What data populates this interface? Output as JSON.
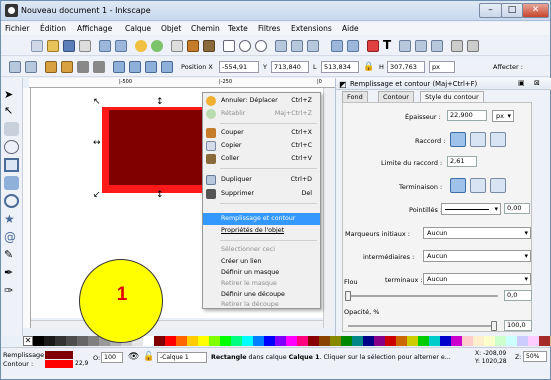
{
  "window": {
    "title": "Nouveau document 1 - Inkscape",
    "min": "–",
    "max": "□",
    "close": "✕"
  },
  "menu": [
    "Fichier",
    "Édition",
    "Affichage",
    "Calque",
    "Objet",
    "Chemin",
    "Texte",
    "Filtres",
    "Extensions",
    "Aide"
  ],
  "toolbar": {
    "position_x_label": "Position X",
    "x_value": "-554,91",
    "y_label": "Y",
    "y_value": "713,840",
    "w_label": "L",
    "w_value": "513,834",
    "h_label": "H",
    "h_value": "307,763",
    "unit": "px",
    "affecter": "Affecter :"
  },
  "ruler": {
    "tick_1": "|-500",
    "tick_2": "|-250",
    "tick_3": "|0"
  },
  "context_menu": [
    {
      "label": "Annuler: Déplacer",
      "shortcut": "Ctrl+Z",
      "disabled": false,
      "icon": "undo-icon"
    },
    {
      "label": "Rétablir",
      "shortcut": "Maj+Ctrl+Z",
      "disabled": true,
      "icon": "redo-icon"
    },
    {
      "label": "Couper",
      "shortcut": "Ctrl+X",
      "disabled": false,
      "icon": "cut-icon"
    },
    {
      "label": "Copier",
      "shortcut": "Ctrl+C",
      "disabled": false,
      "icon": "copy-icon"
    },
    {
      "label": "Coller",
      "shortcut": "Ctrl+V",
      "disabled": false,
      "icon": "paste-icon"
    },
    {
      "label": "Dupliquer",
      "shortcut": "Ctrl+D",
      "disabled": false,
      "icon": "duplicate-icon"
    },
    {
      "label": "Supprimer",
      "shortcut": "Del",
      "disabled": false,
      "icon": "delete-icon"
    },
    {
      "label": "Remplissage et contour",
      "shortcut": "",
      "disabled": false,
      "highlight": true
    },
    {
      "label": "Propriétés de l'objet",
      "shortcut": "",
      "disabled": false
    },
    {
      "label": "Sélectionner ceci",
      "shortcut": "",
      "disabled": true
    },
    {
      "label": "Créer un lien",
      "shortcut": "",
      "disabled": false
    },
    {
      "label": "Définir un masque",
      "shortcut": "",
      "disabled": false
    },
    {
      "label": "Retirer le masque",
      "shortcut": "",
      "disabled": true
    },
    {
      "label": "Définir une découpe",
      "shortcut": "",
      "disabled": false
    },
    {
      "label": "Retirer la découpe",
      "shortcut": "",
      "disabled": true
    }
  ],
  "panel": {
    "title": "Remplissage et contour (Maj+Ctrl+F)",
    "tabs": [
      "Fond",
      "Contour",
      "Style du contour"
    ],
    "epaisseur_label": "Épaisseur :",
    "epaisseur_value": "22,900",
    "epaisseur_unit": "px",
    "raccord_label": "Raccord :",
    "limite_label": "Limite du raccord :",
    "limite_value": "2,61",
    "terminaison_label": "Terminaison :",
    "pointilles_label": "Pointillés :",
    "pointilles_value": "0,00",
    "marqueurs_initiaux_label": "Marqueurs initiaux :",
    "intermediaires_label": "intermédiaires :",
    "terminaux_label": "terminaux :",
    "aucun": "Aucun",
    "flou_label": "Flou",
    "flou_value": "0,0",
    "opacite_label": "Opacité, %",
    "opacite_value": "100,0"
  },
  "status": {
    "remplissage_label": "Remplissage :",
    "contour_label": "Contour :",
    "stroke_width": "22,9",
    "opacity_label": "O:",
    "opacity_value": "100",
    "layer": "-Calque 1",
    "message_bold": "Rectangle",
    "message_1": " dans calque ",
    "message_layer": "Calque 1",
    "message_2": ". Cliquer sur la sélection pour alterner e...",
    "x_coord": "X: -208,09",
    "y_coord": "Y: 1020,28",
    "z_label": "Z:",
    "zoom": "50%"
  },
  "badge": "1",
  "colors": {
    "fill": "#ff0000",
    "inner": "#800000",
    "accent": "#3399ff"
  }
}
